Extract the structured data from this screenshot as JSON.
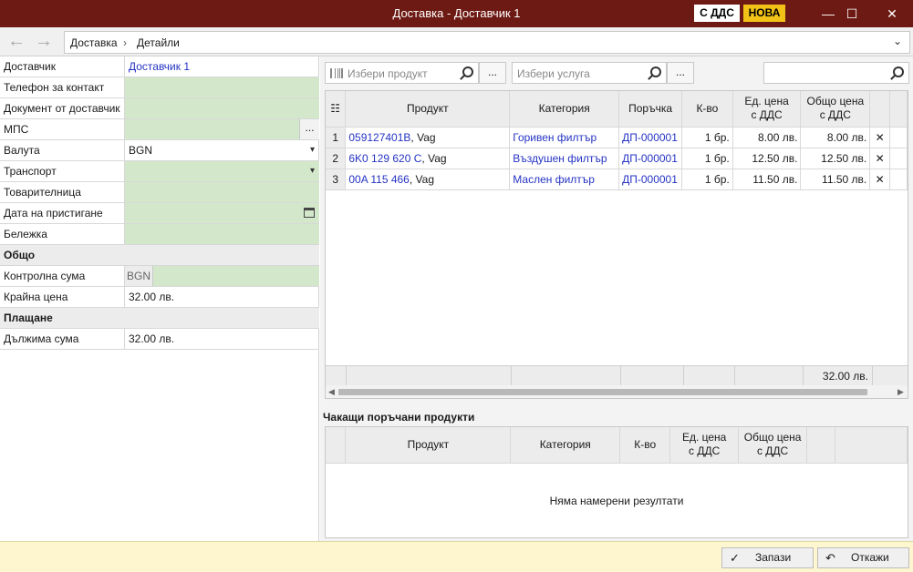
{
  "window": {
    "title": "Доставка - Доставчик 1",
    "badge_vat": "С ДДС",
    "badge_new": "НОВА",
    "minimize": "—",
    "maximize": "☐",
    "close": "✕"
  },
  "nav": {
    "back": "←",
    "forward": "→",
    "breadcrumb": [
      "Доставка",
      "Детайли"
    ],
    "separator": "›",
    "dropdown": "⌄"
  },
  "form": {
    "supplier": {
      "label": "Доставчик",
      "value": "Доставчик 1"
    },
    "phone": {
      "label": "Телефон за контакт",
      "value": ""
    },
    "supplier_doc": {
      "label": "Документ от доставчик",
      "value": ""
    },
    "mps": {
      "label": "МПС",
      "value": "",
      "button": "..."
    },
    "currency": {
      "label": "Валута",
      "value": "BGN"
    },
    "transport": {
      "label": "Транспорт",
      "value": ""
    },
    "waybill": {
      "label": "Товарителница",
      "value": ""
    },
    "arrival_date": {
      "label": "Дата на пристигане",
      "value": ""
    },
    "note": {
      "label": "Бележка",
      "value": ""
    },
    "section_total": "Общо",
    "control_sum": {
      "label": "Контролна сума",
      "currency": "BGN",
      "value": ""
    },
    "final_price": {
      "label": "Крайна цена",
      "value": "32.00 лв."
    },
    "section_payment": "Плащане",
    "due_amount": {
      "label": "Дължима сума",
      "value": "32.00 лв."
    }
  },
  "search": {
    "product_placeholder": "Избери продукт",
    "service_placeholder": "Избери услуга",
    "free_placeholder": "",
    "dots": "..."
  },
  "grid": {
    "headers": {
      "product": "Продукт",
      "category": "Категория",
      "order": "Поръчка",
      "qty": "К-во",
      "unit_price_1": "Ед. цена",
      "unit_price_2": "с ДДС",
      "total_price_1": "Общо цена",
      "total_price_2": "с ДДС"
    },
    "rows": [
      {
        "n": "1",
        "code": "059127401B",
        "brand": ", Vag",
        "category": "Горивен филтър",
        "order": "ДП-000001",
        "qty": "1 бр.",
        "unit": "8.00 лв.",
        "total": "8.00 лв.",
        "del": "✕"
      },
      {
        "n": "2",
        "code": "6K0 129 620 C",
        "brand": ", Vag",
        "category": "Въздушен филтър",
        "order": "ДП-000001",
        "qty": "1 бр.",
        "unit": "12.50 лв.",
        "total": "12.50 лв.",
        "del": "✕"
      },
      {
        "n": "3",
        "code": "00A 115 466",
        "brand": ", Vag",
        "category": "Маслен филтър",
        "order": "ДП-000001",
        "qty": "1 бр.",
        "unit": "11.50 лв.",
        "total": "11.50 лв.",
        "del": "✕"
      }
    ],
    "footer_total": "32.00 лв."
  },
  "pending": {
    "title": "Чакащи поръчани продукти",
    "headers": {
      "product": "Продукт",
      "category": "Категория",
      "qty": "К-во",
      "unit_price_1": "Ед. цена",
      "unit_price_2": "с ДДС",
      "total_price_1": "Общо цена",
      "total_price_2": "с ДДС"
    },
    "empty": "Няма намерени резултати"
  },
  "buttons": {
    "save": "Запази",
    "save_icon": "✓",
    "cancel": "Откажи",
    "cancel_icon": "↶"
  }
}
